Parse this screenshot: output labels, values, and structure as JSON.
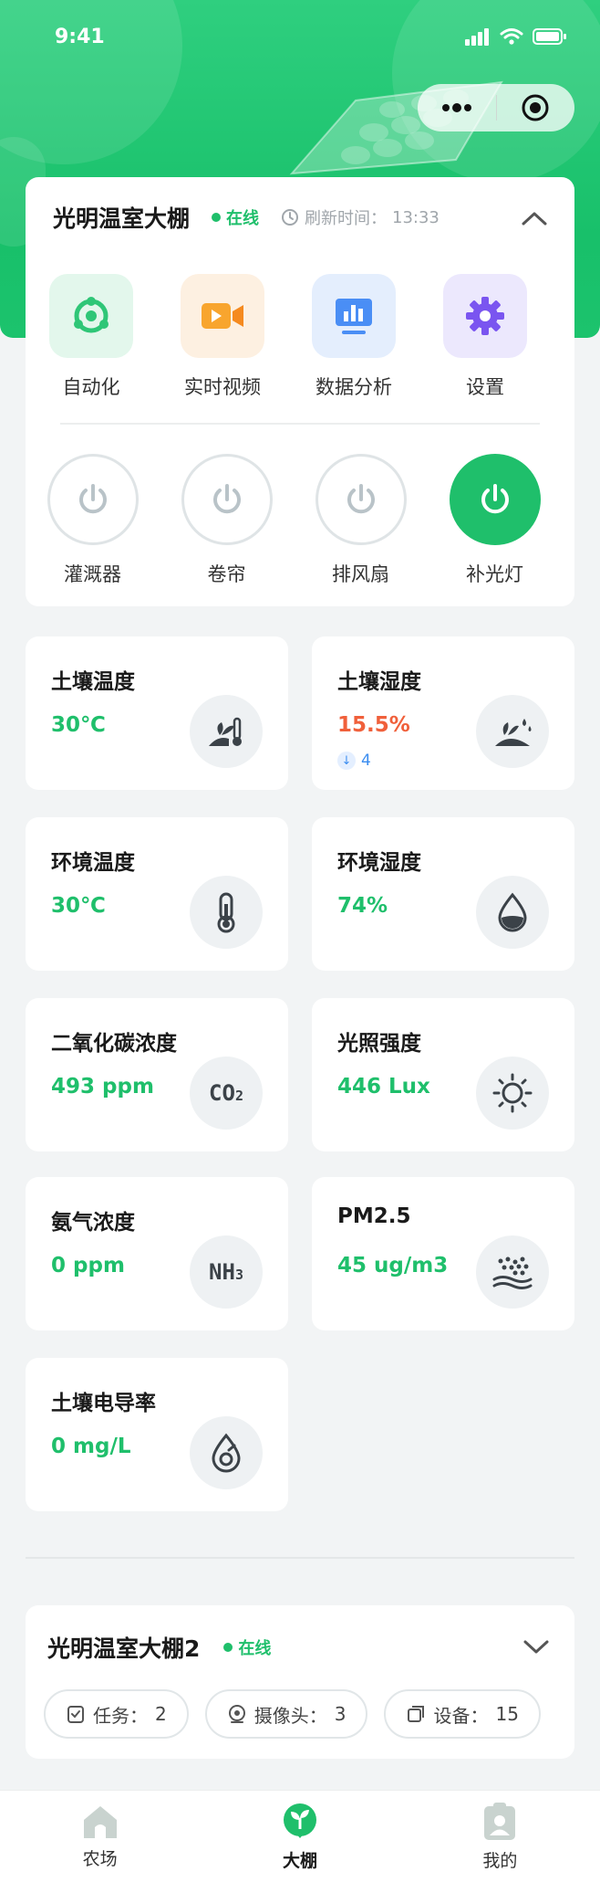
{
  "status_bar": {
    "time": "9:41"
  },
  "greenhouse": {
    "title": "光明温室大棚",
    "status": "在线",
    "refresh_label": "刷新时间：",
    "refresh_time": "13:33"
  },
  "functions": [
    {
      "label": "自动化",
      "icon": "automation-icon"
    },
    {
      "label": "实时视频",
      "icon": "video-camera-icon"
    },
    {
      "label": "数据分析",
      "icon": "data-monitor-icon"
    },
    {
      "label": "设置",
      "icon": "gear-icon"
    }
  ],
  "devices": [
    {
      "label": "灌溉器",
      "on": false
    },
    {
      "label": "卷帘",
      "on": false
    },
    {
      "label": "排风扇",
      "on": false
    },
    {
      "label": "补光灯",
      "on": true
    }
  ],
  "sensors": [
    {
      "name": "土壤温度",
      "value": "30℃",
      "icon": "soil-thermometer-icon"
    },
    {
      "name": "土壤湿度",
      "value": "15.5%",
      "warn": true,
      "trend": "4",
      "icon": "soil-moisture-icon"
    },
    {
      "name": "环境温度",
      "value": "30℃",
      "icon": "thermometer-icon"
    },
    {
      "name": "环境湿度",
      "value": "74%",
      "icon": "water-drop-icon"
    },
    {
      "name": "二氧化碳浓度",
      "value": "493 ppm",
      "icon": "co2-icon",
      "icon_text": "CO",
      "icon_sub": "2"
    },
    {
      "name": "光照强度",
      "value": "446 Lux",
      "icon": "sun-icon"
    },
    {
      "name": "氨气浓度",
      "value": "0 ppm",
      "icon": "nh3-icon",
      "icon_text": "NH",
      "icon_sub": "3"
    },
    {
      "name": "PM2.5",
      "value": "45 ug/m3",
      "icon": "particles-icon"
    },
    {
      "name": "土壤电导率",
      "value": "0 mg/L",
      "icon": "conductivity-icon"
    }
  ],
  "greenhouse2": {
    "title": "光明温室大棚2",
    "status": "在线",
    "chips": [
      {
        "label": "任务：",
        "count": "2",
        "icon": "task-icon"
      },
      {
        "label": "摄像头：",
        "count": "3",
        "icon": "camera-icon"
      },
      {
        "label": "设备：",
        "count": "15",
        "icon": "device-icon"
      }
    ]
  },
  "tabbar": [
    {
      "label": "农场",
      "active": false
    },
    {
      "label": "大棚",
      "active": true
    },
    {
      "label": "我的",
      "active": false
    }
  ],
  "colors": {
    "accent": "#1fbf6b",
    "warn": "#f0603b",
    "trend": "#3b8df0"
  }
}
